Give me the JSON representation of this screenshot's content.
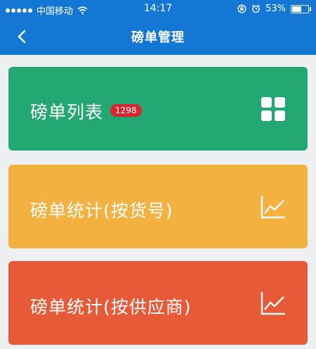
{
  "status_bar": {
    "carrier": "中国移动",
    "time": "14:17",
    "battery": "53%",
    "battery_level": 0.53,
    "signal_icon": "signal-dots-icon",
    "wifi_icon": "wifi-icon",
    "lock_icon": "rotation-lock-icon",
    "alarm_icon": "alarm-icon"
  },
  "nav": {
    "title": "磅单管理",
    "back_icon": "chevron-left-icon",
    "color": "#1577d4"
  },
  "cards": [
    {
      "label": "磅单列表",
      "badge": "1298",
      "icon": "grid-icon",
      "color": "#23a873"
    },
    {
      "label": "磅单统计(按货号)",
      "icon": "line-chart-icon",
      "color": "#f3b13f"
    },
    {
      "label": "磅单统计(按供应商)",
      "icon": "line-chart-icon",
      "color": "#e75a38"
    }
  ]
}
